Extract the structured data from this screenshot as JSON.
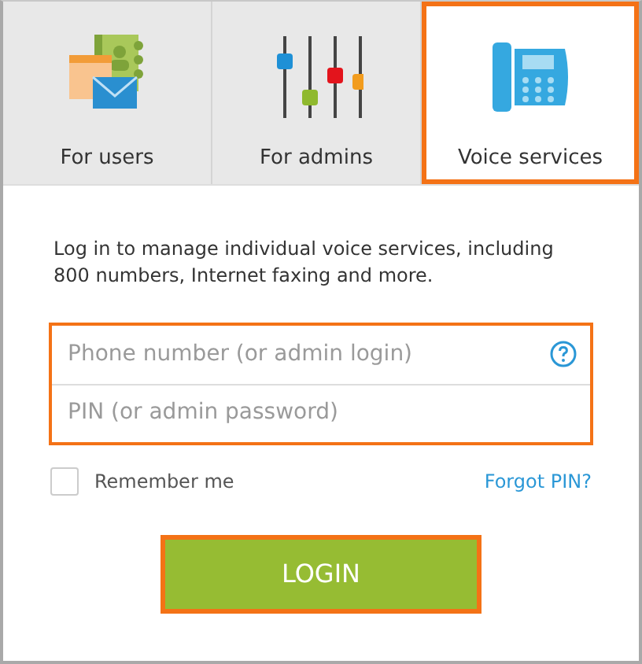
{
  "tabs": [
    {
      "label": "For users",
      "kind": "contacts",
      "selected": false
    },
    {
      "label": "For admins",
      "kind": "sliders",
      "selected": false
    },
    {
      "label": "Voice services",
      "kind": "phone",
      "selected": true
    }
  ],
  "description": "Log in to manage individual voice services, including 800 numbers, Internet faxing and more.",
  "fields": [
    {
      "placeholder": "Phone number (or admin login)",
      "help": true
    },
    {
      "placeholder": "PIN (or admin password)",
      "help": false
    }
  ],
  "remember": {
    "label": "Remember me",
    "checked": false
  },
  "forgot_link": "Forgot PIN?",
  "login_button": "LOGIN"
}
